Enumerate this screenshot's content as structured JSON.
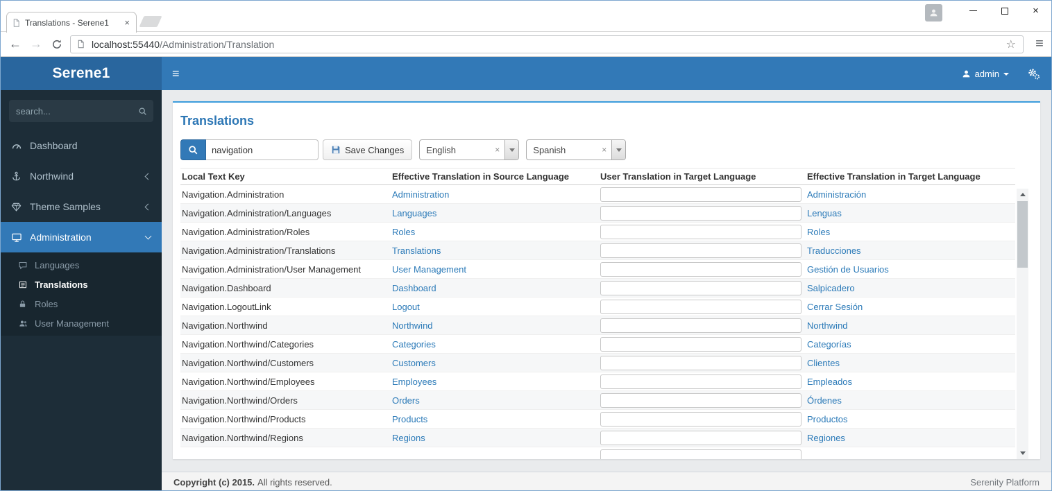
{
  "browser": {
    "tab_title": "Translations - Serene1",
    "url_host": "localhost:55440",
    "url_path": "/Administration/Translation"
  },
  "icons": {
    "back": "←",
    "forward": "→",
    "star": "☆",
    "menu": "≡",
    "sidebar_toggle": "≡",
    "tab_close": "×",
    "window_close": "×",
    "select_clear": "×"
  },
  "navbar": {
    "brand": "Serene1",
    "user_label": "admin"
  },
  "sidebar": {
    "search_placeholder": "search...",
    "items": [
      {
        "label": "Dashboard",
        "icon": "tachometer-icon"
      },
      {
        "label": "Northwind",
        "icon": "anchor-icon",
        "chevron": "left"
      },
      {
        "label": "Theme Samples",
        "icon": "gem-icon",
        "chevron": "left"
      },
      {
        "label": "Administration",
        "icon": "monitor-icon",
        "chevron": "down",
        "active": true
      }
    ],
    "sub_items": [
      {
        "label": "Languages",
        "icon": "comment-icon"
      },
      {
        "label": "Translations",
        "icon": "file-text-icon",
        "active": true
      },
      {
        "label": "Roles",
        "icon": "lock-icon"
      },
      {
        "label": "User Management",
        "icon": "users-icon"
      }
    ]
  },
  "page": {
    "title": "Translations",
    "search_value": "navigation",
    "save_label": "Save Changes",
    "source_language": "English",
    "target_language": "Spanish"
  },
  "table": {
    "headers": [
      "Local Text Key",
      "Effective Translation in Source Language",
      "User Translation in Target Language",
      "Effective Translation in Target Language"
    ],
    "rows": [
      {
        "key": "Navigation.Administration",
        "source": "Administration",
        "user": "",
        "target": "Administración"
      },
      {
        "key": "Navigation.Administration/Languages",
        "source": "Languages",
        "user": "",
        "target": "Lenguas"
      },
      {
        "key": "Navigation.Administration/Roles",
        "source": "Roles",
        "user": "",
        "target": "Roles"
      },
      {
        "key": "Navigation.Administration/Translations",
        "source": "Translations",
        "user": "",
        "target": "Traducciones"
      },
      {
        "key": "Navigation.Administration/User Management",
        "source": "User Management",
        "user": "",
        "target": "Gestión de Usuarios"
      },
      {
        "key": "Navigation.Dashboard",
        "source": "Dashboard",
        "user": "",
        "target": "Salpicadero"
      },
      {
        "key": "Navigation.LogoutLink",
        "source": "Logout",
        "user": "",
        "target": "Cerrar Sesión"
      },
      {
        "key": "Navigation.Northwind",
        "source": "Northwind",
        "user": "",
        "target": "Northwind"
      },
      {
        "key": "Navigation.Northwind/Categories",
        "source": "Categories",
        "user": "",
        "target": "Categorías"
      },
      {
        "key": "Navigation.Northwind/Customers",
        "source": "Customers",
        "user": "",
        "target": "Clientes"
      },
      {
        "key": "Navigation.Northwind/Employees",
        "source": "Employees",
        "user": "",
        "target": "Empleados"
      },
      {
        "key": "Navigation.Northwind/Orders",
        "source": "Orders",
        "user": "",
        "target": "Órdenes"
      },
      {
        "key": "Navigation.Northwind/Products",
        "source": "Products",
        "user": "",
        "target": "Productos"
      },
      {
        "key": "Navigation.Northwind/Regions",
        "source": "Regions",
        "user": "",
        "target": "Regiones"
      },
      {
        "key": "",
        "source": "",
        "user": "",
        "target": ""
      }
    ]
  },
  "footer": {
    "copyright_strong": "Copyright (c) 2015.",
    "copyright_text": "All rights reserved.",
    "platform": "Serenity Platform"
  },
  "colors": {
    "navbar_blue": "#3279b7",
    "brand_blue": "#29669e",
    "sidebar_dark": "#1d2d38",
    "panel_accent": "#3c9cdc",
    "link_blue": "#2b7ab8"
  }
}
